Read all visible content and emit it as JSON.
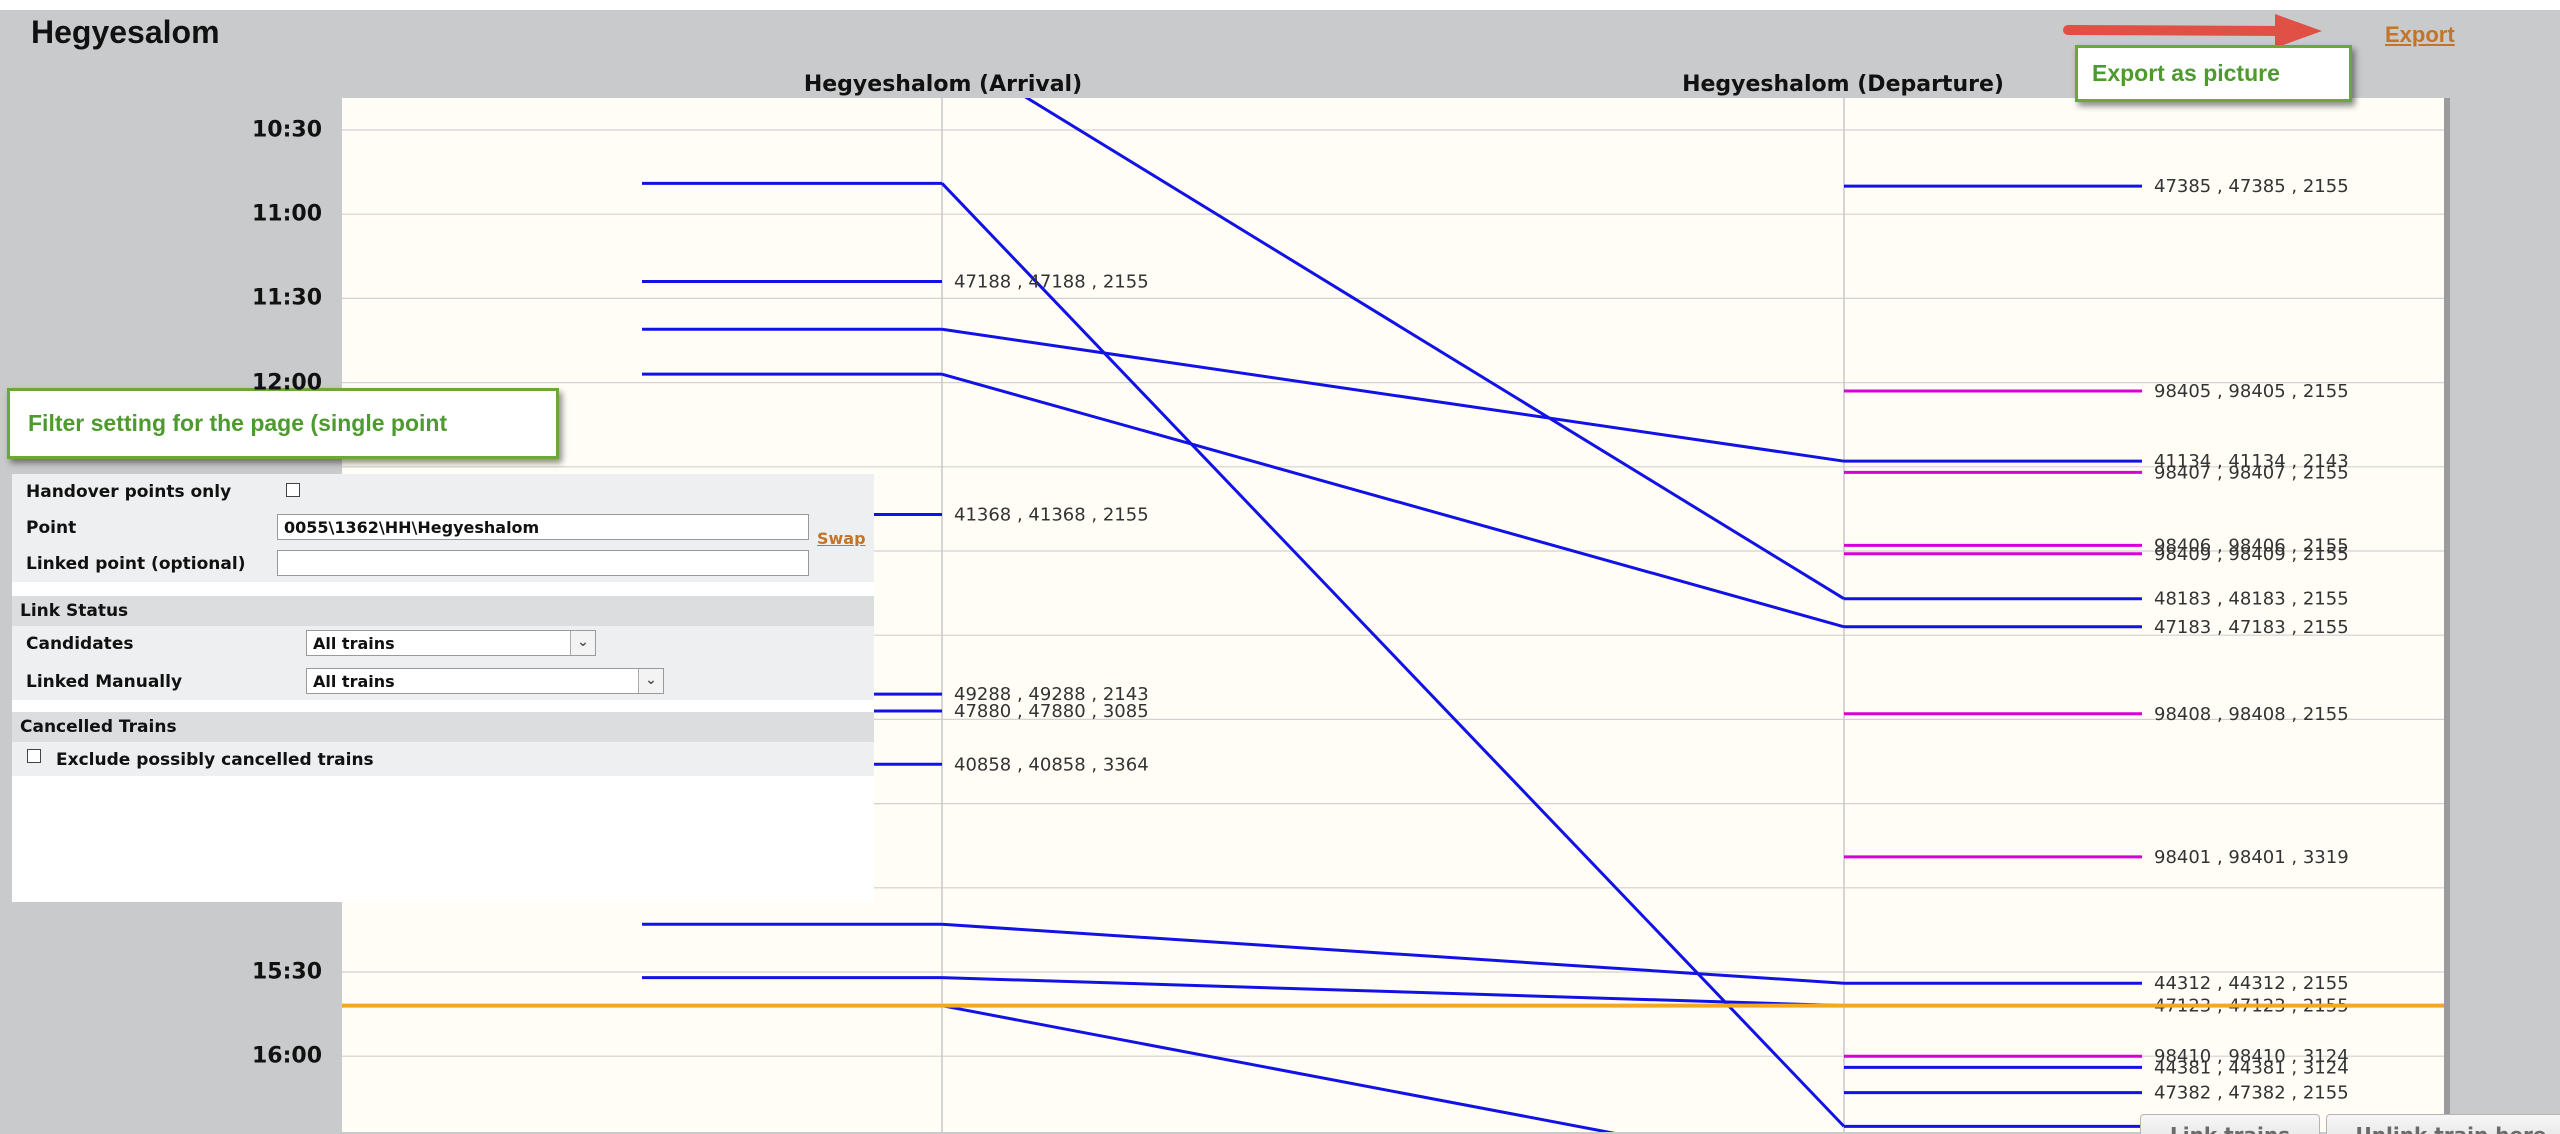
{
  "page": {
    "title": "Hegyesalom"
  },
  "toolbar": {
    "export_label": "Export"
  },
  "annotations": {
    "export_callout": "Export as picture",
    "filter_callout": "Filter setting for the page (single point"
  },
  "columns": {
    "arrival": "Hegyeshalom (Arrival)",
    "departure": "Hegyeshalom (Departure)"
  },
  "time_axis": {
    "visible_ticks": [
      {
        "label": "10:30",
        "minutes": 630
      },
      {
        "label": "11:00",
        "minutes": 660
      },
      {
        "label": "11:30",
        "minutes": 690
      },
      {
        "label": "12:00",
        "minutes": 720
      },
      {
        "label": "15:30",
        "minutes": 930
      },
      {
        "label": "16:00",
        "minutes": 960
      }
    ],
    "gridlines_minutes": [
      630,
      660,
      690,
      720,
      750,
      780,
      810,
      840,
      870,
      900,
      930,
      960
    ],
    "current_time_minutes": 942,
    "current_time_color": "#f5a623"
  },
  "colors": {
    "linked": "#1212e6",
    "unlinked": "#d800d8",
    "callout_green": "#4d9b2f",
    "link_orange": "#c4742a"
  },
  "filter": {
    "handover_label": "Handover points only",
    "handover_checked": false,
    "point_label": "Point",
    "point_value": "0055\\1362\\HH\\Hegyeshalom",
    "swap_label": "Swap",
    "linked_point_label": "Linked point (optional)",
    "linked_point_value": "",
    "link_status_header": "Link Status",
    "candidates_label": "Candidates",
    "candidates_value": "All trains",
    "linked_manually_label": "Linked Manually",
    "linked_manually_value": "All trains",
    "cancelled_header": "Cancelled Trains",
    "exclude_label": "Exclude possibly cancelled trains",
    "exclude_checked": false
  },
  "buttons": {
    "link_trains": "Link trains",
    "unlink_train": "Unlink train here"
  },
  "trains": [
    {
      "arr_label": null,
      "arr_min": 649,
      "dep_label": null,
      "dep_min": 985,
      "status": "linked"
    },
    {
      "arr_label": "47188 , 47188 , 2155",
      "arr_min": 684,
      "dep_label": null,
      "dep_min": null,
      "status": "linked"
    },
    {
      "arr_label": null,
      "arr_min": 701,
      "dep_label": "41134 , 41134 , 2143",
      "dep_min": 748,
      "status": "linked"
    },
    {
      "arr_label": null,
      "arr_min": 717,
      "dep_label": "47183 , 47183 , 2155",
      "dep_min": 807,
      "status": "linked"
    },
    {
      "arr_label": "41368 , 41368 , 2155",
      "arr_min": 767,
      "dep_label": null,
      "dep_min": null,
      "status": "linked"
    },
    {
      "arr_label": "49288 , 49288 , 2143",
      "arr_min": 831,
      "dep_label": null,
      "dep_min": null,
      "status": "linked"
    },
    {
      "arr_label": "47880 , 47880 , 3085",
      "arr_min": 837,
      "dep_label": null,
      "dep_min": null,
      "status": "linked"
    },
    {
      "arr_label": "40858 , 40858 , 3364",
      "arr_min": 856,
      "dep_label": null,
      "dep_min": null,
      "status": "linked"
    },
    {
      "arr_label": null,
      "arr_min": 913,
      "dep_label": "44312 , 44312 , 2155",
      "dep_min": 934,
      "status": "linked"
    },
    {
      "arr_label": null,
      "arr_min": 932,
      "dep_label": "47123 , 47123 , 2155",
      "dep_min": 942,
      "status": "linked"
    },
    {
      "arr_label": null,
      "arr_min": 942,
      "dep_label": null,
      "dep_min": 1003,
      "status": "linked"
    },
    {
      "arr_label": null,
      "arr_min": 600,
      "dep_label": "48183 , 48183 , 2155",
      "dep_min": 797,
      "status": "linked"
    },
    {
      "arr_label": null,
      "arr_min": null,
      "dep_label": "47385 , 47385 , 2155",
      "dep_min": 650,
      "status": "linked"
    },
    {
      "arr_label": null,
      "arr_min": null,
      "dep_label": "44381 , 44381 , 3124",
      "dep_min": 964,
      "status": "linked"
    },
    {
      "arr_label": null,
      "arr_min": null,
      "dep_label": "47382 , 47382 , 2155",
      "dep_min": 973,
      "status": "linked"
    },
    {
      "arr_label": null,
      "arr_min": null,
      "dep_label": "98405 , 98405 , 2155",
      "dep_min": 723,
      "status": "unlinked"
    },
    {
      "arr_label": null,
      "arr_min": null,
      "dep_label": "98407 , 98407 , 2155",
      "dep_min": 752,
      "status": "unlinked"
    },
    {
      "arr_label": null,
      "arr_min": null,
      "dep_label": "98406 , 98406 , 2155",
      "dep_min": 778,
      "status": "unlinked"
    },
    {
      "arr_label": null,
      "arr_min": null,
      "dep_label": "98409 , 98409 , 2155",
      "dep_min": 781,
      "status": "unlinked"
    },
    {
      "arr_label": null,
      "arr_min": null,
      "dep_label": "98408 , 98408 , 2155",
      "dep_min": 838,
      "status": "unlinked"
    },
    {
      "arr_label": null,
      "arr_min": null,
      "dep_label": "98401 , 98401 , 3319",
      "dep_min": 889,
      "status": "unlinked"
    },
    {
      "arr_label": null,
      "arr_min": null,
      "dep_label": "98410 , 98410 , 3124",
      "dep_min": 960,
      "status": "unlinked"
    }
  ]
}
